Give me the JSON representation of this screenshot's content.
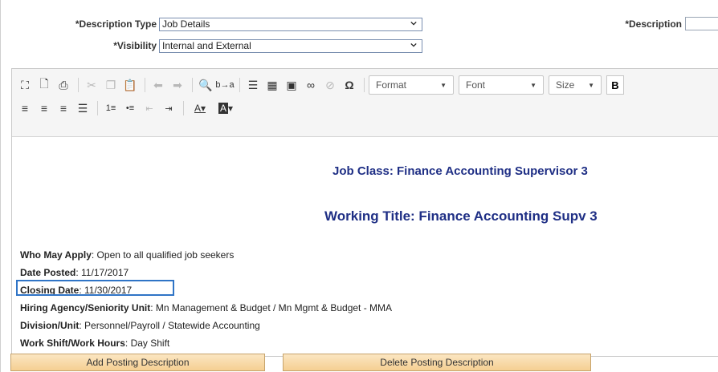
{
  "form": {
    "description_type_label": "*Description Type",
    "description_type_value": "Job Details",
    "visibility_label": "*Visibility",
    "visibility_value": "Internal and External",
    "description_label": "*Description"
  },
  "toolbar": {
    "row1_icons": [
      "maximize-icon",
      "preview-icon",
      "print-icon",
      "cut-icon",
      "copy-icon",
      "paste-icon",
      "undo-icon",
      "redo-icon",
      "find-icon",
      "replace-icon",
      "align-justify-icon",
      "table-icon",
      "image-icon",
      "link-icon",
      "unlink-icon",
      "special-char-icon"
    ],
    "format_label": "Format",
    "font_label": "Font",
    "size_label": "Size",
    "bold_label": "B",
    "row2_icons": [
      "align-left-icon",
      "align-center-icon",
      "align-right-icon",
      "align-justify-icon",
      "numbered-list-icon",
      "bulleted-list-icon",
      "decrease-indent-icon",
      "increase-indent-icon",
      "text-color-icon",
      "background-color-icon"
    ]
  },
  "content": {
    "job_class": "Job Class:  Finance Accounting Supervisor 3",
    "working_title": "Working Title:  Finance Accounting Supv 3",
    "fields": [
      {
        "label": "Who May Apply",
        "value": ":  Open to all qualified job seekers"
      },
      {
        "label": "Date Posted",
        "value": ":  11/17/2017"
      },
      {
        "label": "Closing Date",
        "value": ":  11/30/2017"
      },
      {
        "label": "Hiring Agency/Seniority Unit",
        "value": ":  Mn Management & Budget / Mn Mgmt & Budget - MMA"
      },
      {
        "label": "Division/Unit",
        "value": ":  Personnel/Payroll / Statewide Accounting"
      },
      {
        "label": "Work Shift/Work Hours",
        "value": ":  Day Shift"
      }
    ]
  },
  "buttons": {
    "add": "Add Posting Description",
    "delete": "Delete Posting Description"
  }
}
